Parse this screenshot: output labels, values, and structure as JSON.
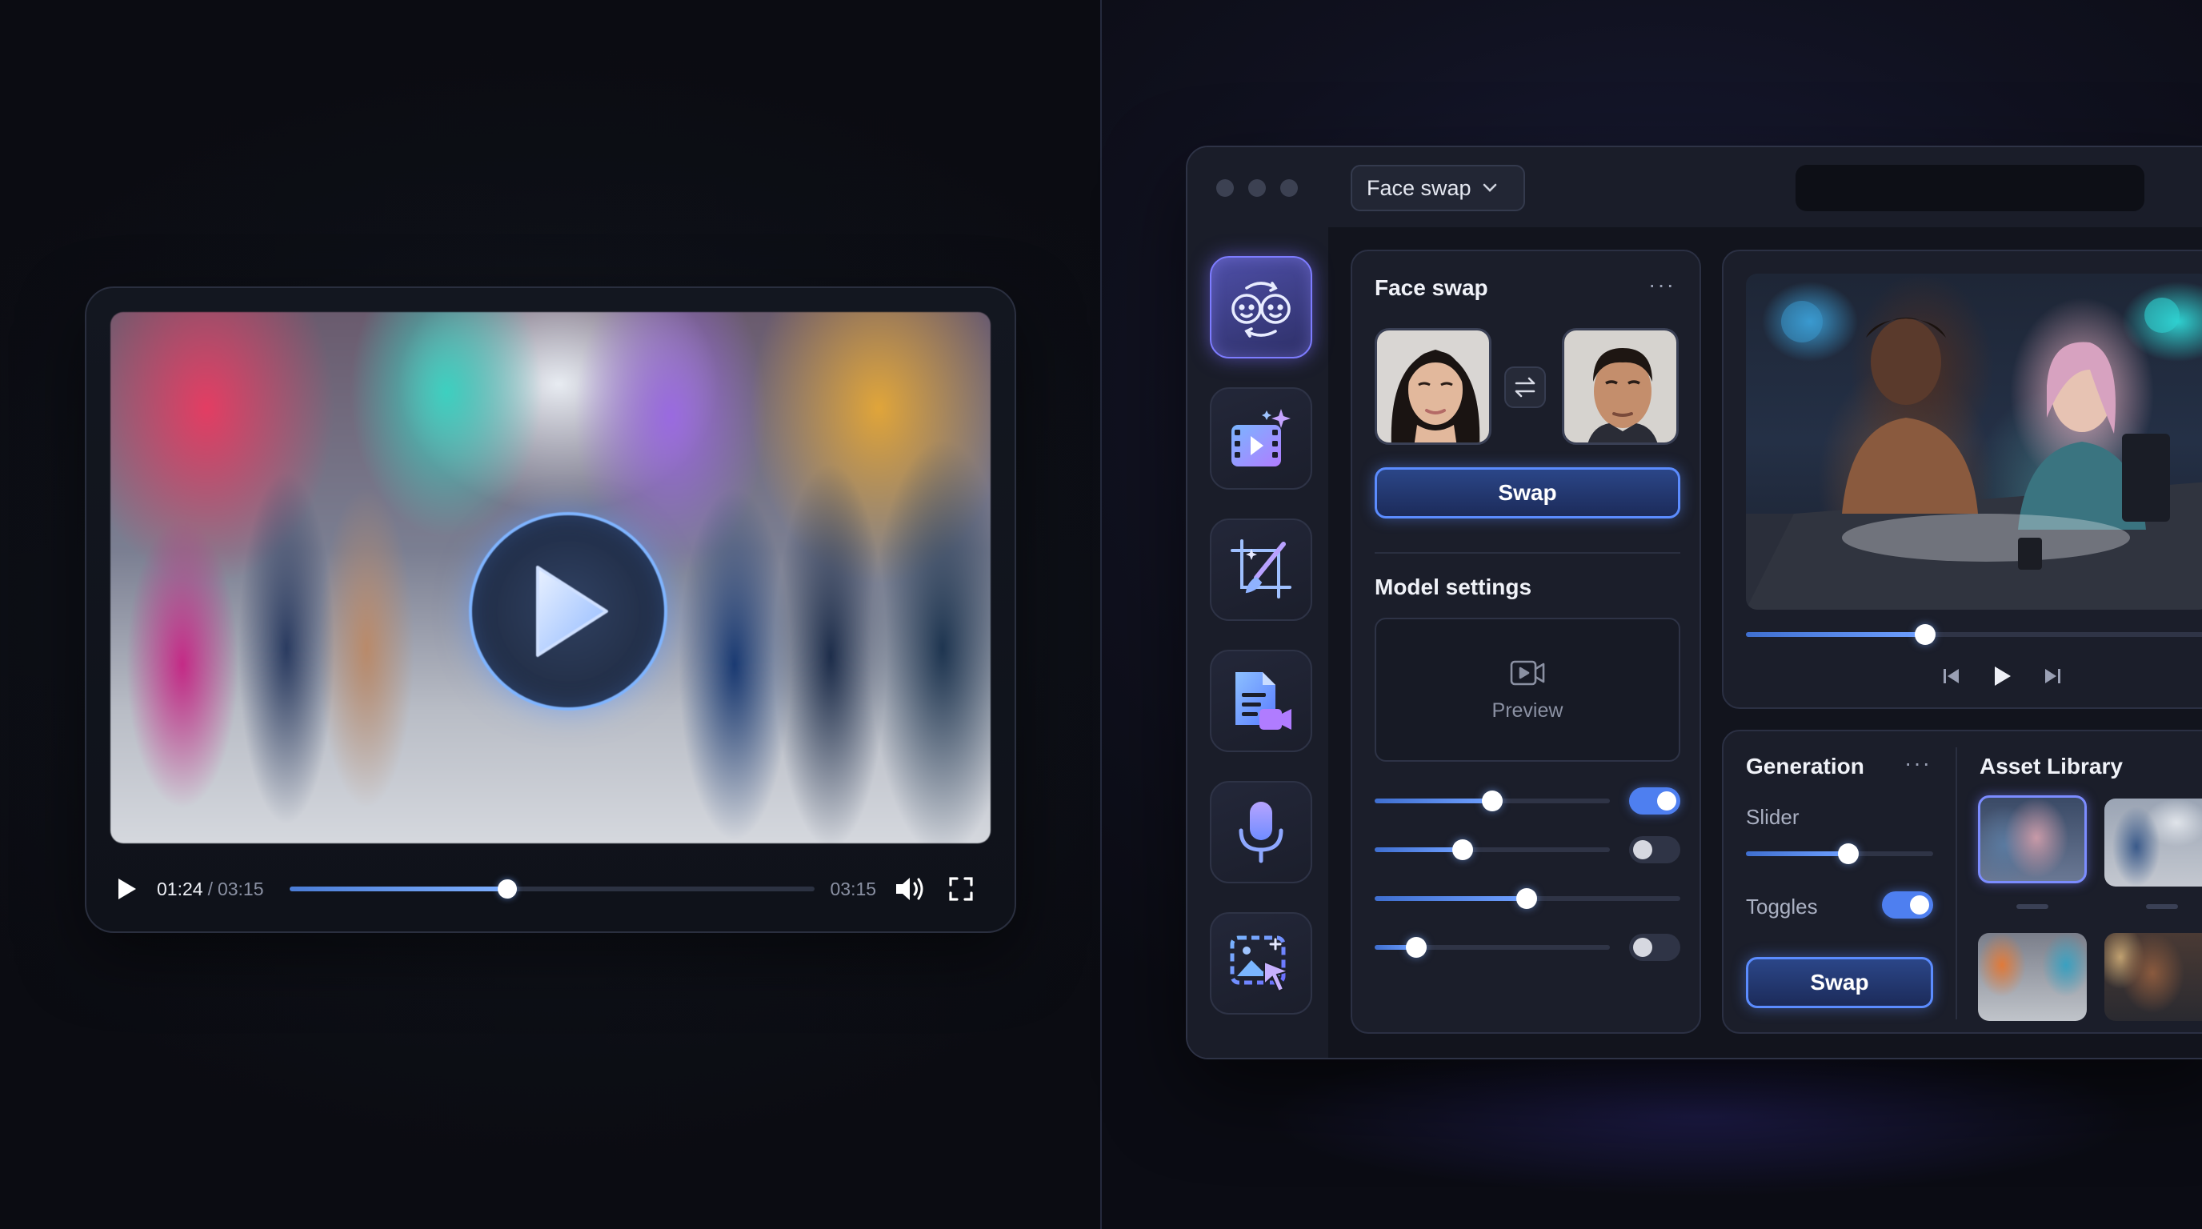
{
  "player": {
    "current_time": "01:24",
    "separator": "/",
    "total_time": "03:15",
    "end_time": "03:15",
    "progress_fraction": 0.415,
    "icons": [
      "play-icon",
      "volume-icon",
      "fullscreen-icon"
    ]
  },
  "app": {
    "mode_dropdown": "Face swap",
    "sidebar_tools": [
      "face-swap-icon",
      "ai-video-icon",
      "crop-edit-icon",
      "script-to-video-icon",
      "microphone-icon",
      "image-select-icon"
    ],
    "face_swap_panel": {
      "title": "Face swap",
      "more": "···",
      "swap_button": "Swap",
      "model_settings_title": "Model settings",
      "preview_label": "Preview",
      "sliders": [
        0.5,
        0.4,
        0.6,
        0.18
      ],
      "toggles": [
        true,
        false,
        null,
        false
      ]
    },
    "preview_panel": {
      "progress_fraction": 0.5
    },
    "generation_panel": {
      "title": "Generation",
      "more": "···",
      "slider_label": "Slider",
      "slider_value": 0.55,
      "toggles_label": "Toggles",
      "toggle_on": true,
      "swap_button": "Swap"
    },
    "asset_library": {
      "title": "Asset Library"
    }
  },
  "colors": {
    "accent": "#5b8cff",
    "active_tool": "#7d7cff",
    "background": "#0d0f16"
  }
}
